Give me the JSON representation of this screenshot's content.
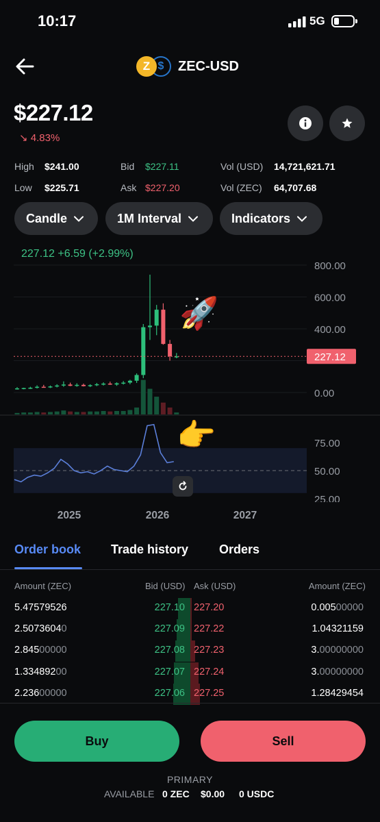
{
  "status": {
    "time": "10:17",
    "network": "5G"
  },
  "header": {
    "pair": "ZEC-USD",
    "coin1_symbol": "Z",
    "coin2_symbol": "$"
  },
  "price": {
    "value": "$227.12",
    "change": "4.83%"
  },
  "stats": {
    "high_label": "High",
    "high": "$241.00",
    "low_label": "Low",
    "low": "$225.71",
    "bid_label": "Bid",
    "bid": "$227.11",
    "ask_label": "Ask",
    "ask": "$227.20",
    "vol_usd_label": "Vol (USD)",
    "vol_usd": "14,721,621.71",
    "vol_zec_label": "Vol (ZEC)",
    "vol_zec": "64,707.68"
  },
  "controls": {
    "chart_type": "Candle",
    "interval": "1M Interval",
    "indicators": "Indicators"
  },
  "chart_data": {
    "type": "candlestick",
    "header": "227.12  +6.59 (+2.99%)",
    "price_ticks": [
      "800.00",
      "600.00",
      "400.00",
      "0.00"
    ],
    "current_price_label": "227.12",
    "rsi_ticks": [
      "75.00",
      "50.00",
      "25.00"
    ],
    "x_ticks": [
      "2025",
      "2026",
      "2027"
    ],
    "candles": [
      {
        "o": 24,
        "h": 34,
        "l": 18,
        "c": 26
      },
      {
        "o": 26,
        "h": 30,
        "l": 20,
        "c": 28
      },
      {
        "o": 28,
        "h": 36,
        "l": 22,
        "c": 30
      },
      {
        "o": 30,
        "h": 45,
        "l": 25,
        "c": 36
      },
      {
        "o": 36,
        "h": 48,
        "l": 30,
        "c": 34
      },
      {
        "o": 34,
        "h": 44,
        "l": 28,
        "c": 38
      },
      {
        "o": 38,
        "h": 52,
        "l": 32,
        "c": 44
      },
      {
        "o": 44,
        "h": 70,
        "l": 36,
        "c": 50
      },
      {
        "o": 50,
        "h": 62,
        "l": 40,
        "c": 42
      },
      {
        "o": 42,
        "h": 58,
        "l": 36,
        "c": 48
      },
      {
        "o": 48,
        "h": 56,
        "l": 38,
        "c": 40
      },
      {
        "o": 40,
        "h": 52,
        "l": 34,
        "c": 46
      },
      {
        "o": 46,
        "h": 60,
        "l": 40,
        "c": 52
      },
      {
        "o": 52,
        "h": 64,
        "l": 44,
        "c": 56
      },
      {
        "o": 56,
        "h": 68,
        "l": 48,
        "c": 50
      },
      {
        "o": 50,
        "h": 64,
        "l": 42,
        "c": 58
      },
      {
        "o": 58,
        "h": 72,
        "l": 50,
        "c": 62
      },
      {
        "o": 62,
        "h": 80,
        "l": 52,
        "c": 74
      },
      {
        "o": 74,
        "h": 120,
        "l": 60,
        "c": 110
      },
      {
        "o": 110,
        "h": 430,
        "l": 90,
        "c": 410
      },
      {
        "o": 410,
        "h": 740,
        "l": 330,
        "c": 420
      },
      {
        "o": 420,
        "h": 550,
        "l": 360,
        "c": 520
      },
      {
        "o": 520,
        "h": 560,
        "l": 300,
        "c": 305
      },
      {
        "o": 305,
        "h": 330,
        "l": 200,
        "c": 227
      },
      {
        "o": 227,
        "h": 248,
        "l": 215,
        "c": 227.12
      }
    ],
    "volume": [
      3,
      4,
      4,
      5,
      4,
      5,
      6,
      8,
      6,
      5,
      5,
      6,
      6,
      7,
      6,
      7,
      7,
      9,
      14,
      70,
      52,
      36,
      24,
      14,
      4
    ],
    "rsi": [
      42,
      40,
      44,
      46,
      45,
      48,
      52,
      60,
      56,
      50,
      48,
      49,
      47,
      50,
      54,
      51,
      50,
      49,
      54,
      64,
      90,
      91,
      66,
      57,
      58
    ]
  },
  "tabs": [
    "Order book",
    "Trade history",
    "Orders"
  ],
  "orderbook": {
    "headers": {
      "amount_left": "Amount (ZEC)",
      "bid": "Bid (USD)",
      "ask": "Ask (USD)",
      "amount_right": "Amount (ZEC)"
    },
    "rows": [
      {
        "amt_l": "5.47579526",
        "amt_l_main": "5.47579526",
        "amt_l_dim": "",
        "bid": "227.10",
        "ask": "227.20",
        "amt_r_main": "0.005",
        "amt_r_dim": "00000",
        "bid_depth": 0.45,
        "ask_depth": 0.02
      },
      {
        "amt_l_main": "2.5073604",
        "amt_l_dim": "0",
        "bid": "227.09",
        "ask": "227.22",
        "amt_r_main": "1.04321159",
        "amt_r_dim": "",
        "bid_depth": 0.5,
        "ask_depth": 0.05
      },
      {
        "amt_l_main": "2.845",
        "amt_l_dim": "00000",
        "bid": "227.08",
        "ask": "227.23",
        "amt_r_main": "3.",
        "amt_r_dim": "00000000",
        "bid_depth": 0.56,
        "ask_depth": 0.17
      },
      {
        "amt_l_main": "1.334892",
        "amt_l_dim": "00",
        "bid": "227.07",
        "ask": "227.24",
        "amt_r_main": "3.",
        "amt_r_dim": "00000000",
        "bid_depth": 0.6,
        "ask_depth": 0.29
      },
      {
        "amt_l_main": "2.236",
        "amt_l_dim": "00000",
        "bid": "227.06",
        "ask": "227.25",
        "amt_r_main": "1.28429454",
        "amt_r_dim": "",
        "bid_depth": 0.63,
        "ask_depth": 0.35
      }
    ]
  },
  "actions": {
    "buy": "Buy",
    "sell": "Sell"
  },
  "footer": {
    "portfolio": "PRIMARY",
    "available_label": "AVAILABLE",
    "zec": "0 ZEC",
    "usd": "$0.00",
    "usdc": "0 USDC"
  },
  "colors": {
    "green": "#3dc285",
    "red": "#f0616d",
    "accent": "#588af5",
    "zec": "#f4b728",
    "usdc": "#2775ca"
  }
}
